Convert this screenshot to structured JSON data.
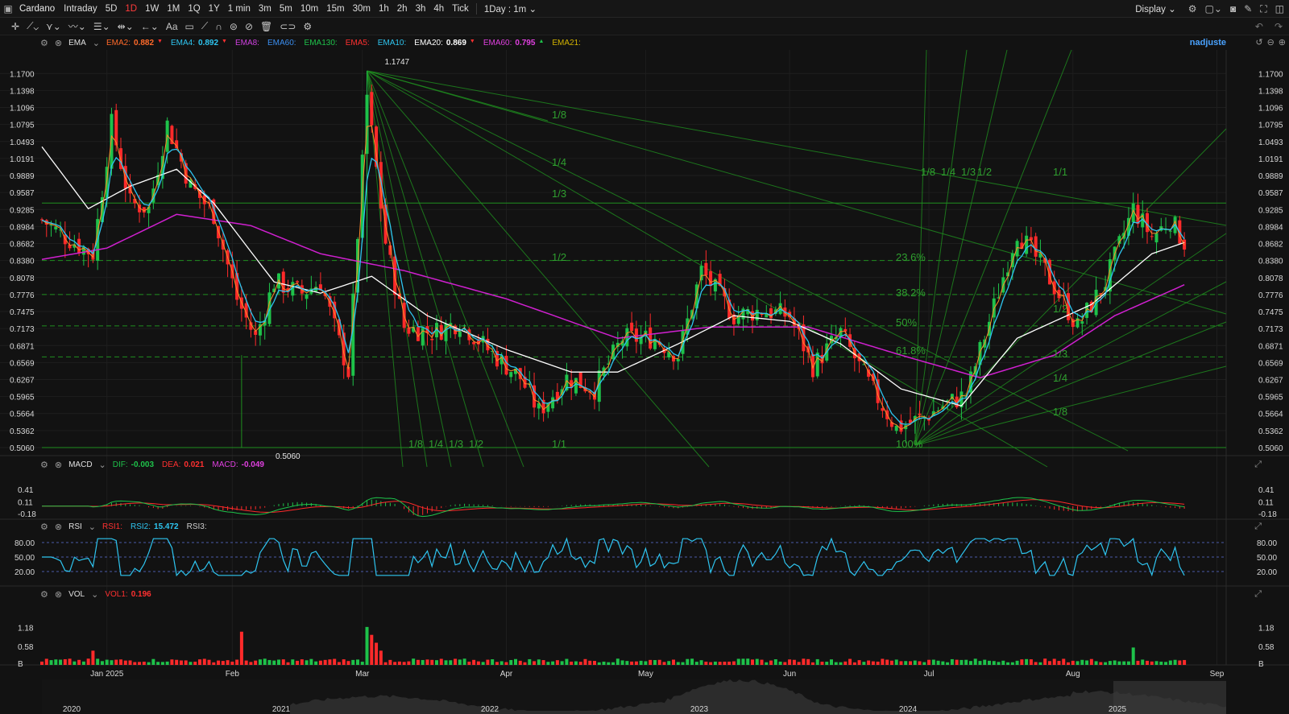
{
  "topbar": {
    "symbol": "Cardano",
    "timeframes": [
      "Intraday",
      "5D",
      "1D",
      "1W",
      "1M",
      "1Q",
      "1Y",
      "1 min",
      "3m",
      "5m",
      "10m",
      "15m",
      "30m",
      "1h",
      "2h",
      "3h",
      "4h",
      "Tick"
    ],
    "active_timeframe": "1D",
    "interval_select": "1Day : 1m",
    "display_label": "Display",
    "accent": "#ff3b3b"
  },
  "toolbar": {
    "tools": [
      "crosshair-icon",
      "line-tool-icon",
      "pitchfork-icon",
      "wave-tool-icon",
      "fib-tool-icon",
      "measure-icon",
      "arrow-tool-icon",
      "text-tool-icon",
      "brush-icon",
      "magnet-icon",
      "lock-icon",
      "hide-icon",
      "trash-icon",
      "link-icon",
      "settings-icon"
    ],
    "text_tool_label": "Aa"
  },
  "ema_legend": {
    "name": "EMA",
    "items": [
      {
        "label": "EMA2:",
        "value": "0.882",
        "color": "#ff6a2a",
        "arrow": "down"
      },
      {
        "label": "EMA4:",
        "value": "0.892",
        "color": "#2ec5f0",
        "arrow": "down"
      },
      {
        "label": "EMA8:",
        "value": "",
        "color": "#d040e0",
        "arrow": ""
      },
      {
        "label": "EMA60:",
        "value": "",
        "color": "#3a8ef0",
        "arrow": ""
      },
      {
        "label": "EMA130:",
        "value": "",
        "color": "#1ec24a",
        "arrow": ""
      },
      {
        "label": "EMA5:",
        "value": "",
        "color": "#ff3030",
        "arrow": ""
      },
      {
        "label": "EMA10:",
        "value": "",
        "color": "#2ec5f0",
        "arrow": ""
      },
      {
        "label": "EMA20:",
        "value": "0.869",
        "color": "#ffffff",
        "arrow": "down"
      },
      {
        "label": "EMA60:",
        "value": "0.795",
        "color": "#e040e0",
        "arrow": "up"
      },
      {
        "label": "EMA21:",
        "value": "",
        "color": "#d4b400",
        "arrow": ""
      }
    ],
    "adjust_label": "nadjuste"
  },
  "price_axis": [
    "1.1700",
    "1.1398",
    "1.1096",
    "1.0795",
    "1.0493",
    "1.0191",
    "0.9889",
    "0.9587",
    "0.9285",
    "0.8984",
    "0.8682",
    "0.8380",
    "0.8078",
    "0.7776",
    "0.7475",
    "0.7173",
    "0.6871",
    "0.6569",
    "0.6267",
    "0.5965",
    "0.5664",
    "0.5362",
    "0.5060"
  ],
  "annotations": {
    "high_label": "1.1747",
    "low_label": "0.5060",
    "gann_left": [
      "1/8",
      "1/4",
      "1/3",
      "1/2",
      "1/1"
    ],
    "gann_top": [
      "1/8",
      "1/4",
      "1/3",
      "1/2"
    ],
    "gann_right_upper": [
      "1/8",
      "1/4",
      "1/3",
      "1/2",
      "1/1"
    ],
    "gann_right_lower": [
      "1/2",
      "1/3",
      "1/4",
      "1/8"
    ],
    "fib_levels": [
      "23.6%",
      "38.2%",
      "50%",
      "61.8%",
      "100%"
    ]
  },
  "macd_legend": {
    "name": "MACD",
    "items": [
      {
        "label": "DIF:",
        "value": "-0.003",
        "color": "#1ec24a"
      },
      {
        "label": "DEA:",
        "value": "0.021",
        "color": "#ff3030"
      },
      {
        "label": "MACD:",
        "value": "-0.049",
        "color": "#e040e0"
      }
    ],
    "axis": [
      "0.41",
      "0.11",
      "-0.18"
    ]
  },
  "rsi_legend": {
    "name": "RSI",
    "items": [
      {
        "label": "RSI1:",
        "value": "",
        "color": "#ff3030"
      },
      {
        "label": "RSI2:",
        "value": "15.472",
        "color": "#2ec5f0"
      },
      {
        "label": "RSI3:",
        "value": "",
        "color": "#cfcfcf"
      }
    ],
    "axis": [
      "80.00",
      "50.00",
      "20.00"
    ]
  },
  "vol_legend": {
    "name": "VOL",
    "items": [
      {
        "label": "VOL1:",
        "value": "0.196",
        "color": "#ff3030"
      }
    ],
    "axis": [
      "1.18",
      "0.58",
      "B"
    ]
  },
  "time_axis": [
    "Jan 2025",
    "Feb",
    "Mar",
    "Apr",
    "May",
    "Jun",
    "Jul",
    "Aug",
    "Sep"
  ],
  "navigator_years": [
    "2020",
    "2021",
    "2022",
    "2023",
    "2024",
    "2025"
  ],
  "colors": {
    "up": "#1ec24a",
    "down": "#ff2a2a",
    "gann": "#1f8f1f",
    "ema20": "#ffffff",
    "ema60": "#d020d0",
    "ema4": "#2ec5f0",
    "ema2": "#ff8a2a"
  },
  "chart_data": {
    "type": "candlestick",
    "symbol": "Cardano",
    "interval": "1D",
    "close_waypoints": [
      [
        "2024-12-22",
        0.91
      ],
      [
        "2024-12-27",
        0.88
      ],
      [
        "2025-01-02",
        0.85
      ],
      [
        "2025-01-06",
        1.08
      ],
      [
        "2025-01-10",
        0.94
      ],
      [
        "2025-01-14",
        0.93
      ],
      [
        "2025-01-18",
        1.08
      ],
      [
        "2025-01-23",
        0.97
      ],
      [
        "2025-01-28",
        0.92
      ],
      [
        "2025-02-02",
        0.77
      ],
      [
        "2025-02-06",
        0.7
      ],
      [
        "2025-02-10",
        0.8
      ],
      [
        "2025-02-16",
        0.78
      ],
      [
        "2025-02-20",
        0.8
      ],
      [
        "2025-02-26",
        0.64
      ],
      [
        "2025-03-02",
        1.13
      ],
      [
        "2025-03-06",
        0.87
      ],
      [
        "2025-03-10",
        0.72
      ],
      [
        "2025-03-16",
        0.71
      ],
      [
        "2025-03-22",
        0.73
      ],
      [
        "2025-03-28",
        0.68
      ],
      [
        "2025-04-04",
        0.63
      ],
      [
        "2025-04-08",
        0.57
      ],
      [
        "2025-04-14",
        0.63
      ],
      [
        "2025-04-20",
        0.61
      ],
      [
        "2025-04-26",
        0.7
      ],
      [
        "2025-05-03",
        0.7
      ],
      [
        "2025-05-08",
        0.67
      ],
      [
        "2025-05-13",
        0.82
      ],
      [
        "2025-05-20",
        0.74
      ],
      [
        "2025-05-26",
        0.75
      ],
      [
        "2025-06-01",
        0.74
      ],
      [
        "2025-06-06",
        0.65
      ],
      [
        "2025-06-12",
        0.71
      ],
      [
        "2025-06-18",
        0.62
      ],
      [
        "2025-06-24",
        0.54
      ],
      [
        "2025-06-30",
        0.56
      ],
      [
        "2025-07-04",
        0.58
      ],
      [
        "2025-07-09",
        0.6
      ],
      [
        "2025-07-14",
        0.73
      ],
      [
        "2025-07-20",
        0.89
      ],
      [
        "2025-07-26",
        0.82
      ],
      [
        "2025-08-02",
        0.72
      ],
      [
        "2025-08-08",
        0.8
      ],
      [
        "2025-08-14",
        0.93
      ],
      [
        "2025-08-18",
        0.88
      ],
      [
        "2025-08-22",
        0.91
      ],
      [
        "2025-08-25",
        0.87
      ]
    ],
    "ema20_waypoints": [
      [
        "2024-12-22",
        1.04
      ],
      [
        "2025-01-01",
        0.93
      ],
      [
        "2025-01-10",
        0.97
      ],
      [
        "2025-01-20",
        1.0
      ],
      [
        "2025-01-28",
        0.94
      ],
      [
        "2025-02-10",
        0.8
      ],
      [
        "2025-02-20",
        0.78
      ],
      [
        "2025-03-03",
        0.81
      ],
      [
        "2025-03-15",
        0.74
      ],
      [
        "2025-04-01",
        0.68
      ],
      [
        "2025-04-15",
        0.64
      ],
      [
        "2025-04-25",
        0.64
      ],
      [
        "2025-05-08",
        0.69
      ],
      [
        "2025-05-20",
        0.74
      ],
      [
        "2025-06-01",
        0.73
      ],
      [
        "2025-06-12",
        0.69
      ],
      [
        "2025-06-25",
        0.61
      ],
      [
        "2025-07-08",
        0.58
      ],
      [
        "2025-07-20",
        0.7
      ],
      [
        "2025-08-05",
        0.76
      ],
      [
        "2025-08-18",
        0.85
      ],
      [
        "2025-08-25",
        0.87
      ]
    ],
    "ema60_waypoints": [
      [
        "2024-12-22",
        0.84
      ],
      [
        "2025-01-05",
        0.86
      ],
      [
        "2025-01-20",
        0.92
      ],
      [
        "2025-02-05",
        0.9
      ],
      [
        "2025-02-20",
        0.85
      ],
      [
        "2025-03-10",
        0.82
      ],
      [
        "2025-04-01",
        0.77
      ],
      [
        "2025-04-25",
        0.7
      ],
      [
        "2025-05-15",
        0.72
      ],
      [
        "2025-06-05",
        0.72
      ],
      [
        "2025-06-25",
        0.67
      ],
      [
        "2025-07-12",
        0.63
      ],
      [
        "2025-07-28",
        0.67
      ],
      [
        "2025-08-10",
        0.74
      ],
      [
        "2025-08-25",
        0.795
      ]
    ],
    "yrange": [
      0.506,
      1.1747
    ],
    "x_range": [
      "2024-12-22",
      "2025-09-03"
    ],
    "high": {
      "date": "2025-03-02",
      "value": 1.1747
    },
    "low": {
      "date": "2025-02-03",
      "value": 0.506
    },
    "indicators": {
      "EMA2": 0.882,
      "EMA4": 0.892,
      "EMA20": 0.869,
      "EMA60": 0.795,
      "DIF": -0.003,
      "DEA": 0.021,
      "MACD": -0.049,
      "RSI2": 15.472,
      "VOL1": 0.196
    },
    "rsi_levels": [
      80,
      50,
      20
    ]
  }
}
